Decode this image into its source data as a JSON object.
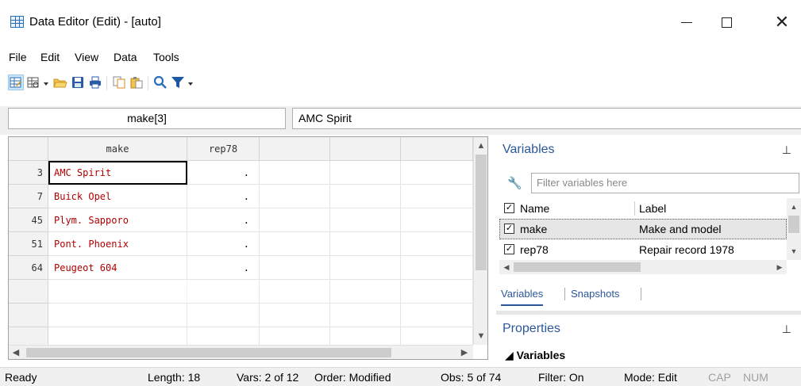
{
  "window": {
    "title": "Data Editor (Edit) - [auto]",
    "minimize_glyph": "—",
    "maximize_glyph": "☐",
    "close_glyph": "✕"
  },
  "menu": [
    "File",
    "Edit",
    "View",
    "Data",
    "Tools"
  ],
  "toolbar": {
    "icons": [
      "edit-mode-icon",
      "browse-mode-icon",
      "open-icon",
      "save-icon",
      "print-icon",
      "copy-icon",
      "paste-icon",
      "find-icon",
      "filter-icon"
    ]
  },
  "cellbar": {
    "name": "make[3]",
    "value": "AMC Spirit"
  },
  "grid": {
    "columns": [
      "make",
      "rep78"
    ],
    "rows": [
      {
        "n": "3",
        "make": "AMC Spirit",
        "rep78": "."
      },
      {
        "n": "7",
        "make": "Buick Opel",
        "rep78": "."
      },
      {
        "n": "45",
        "make": "Plym. Sapporo",
        "rep78": "."
      },
      {
        "n": "51",
        "make": "Pont. Phoenix",
        "rep78": "."
      },
      {
        "n": "64",
        "make": "Peugeot 604",
        "rep78": "."
      }
    ],
    "selected_row": 0
  },
  "variables_pane": {
    "title": "Variables",
    "pin": "📌",
    "filter_placeholder": "Filter variables here",
    "header_name": "Name",
    "header_label": "Label",
    "vars": [
      {
        "name": "make",
        "label": "Make and model",
        "checked": true
      },
      {
        "name": "rep78",
        "label": "Repair record 1978",
        "checked": true
      }
    ],
    "tabs": [
      "Variables",
      "Snapshots"
    ]
  },
  "properties_pane": {
    "title": "Properties",
    "group": "◢ Variables"
  },
  "status": {
    "ready": "Ready",
    "length": "Length: 18",
    "vars": "Vars: 2 of 12",
    "order": "Order: Modified",
    "obs": "Obs: 5 of 74",
    "filter": "Filter: On",
    "mode": "Mode: Edit",
    "cap": "CAP",
    "num": "NUM"
  }
}
